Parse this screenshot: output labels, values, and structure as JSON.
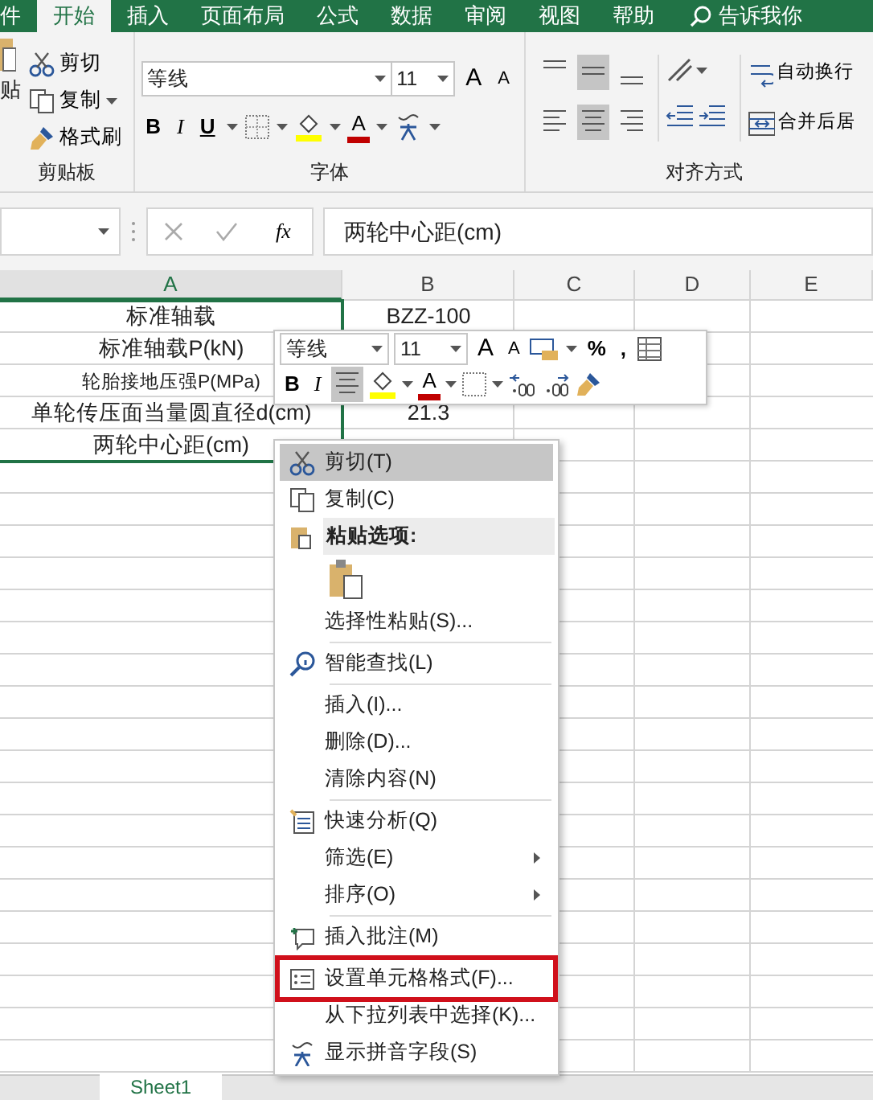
{
  "tabs": [
    {
      "label": "件",
      "selected": false
    },
    {
      "label": "开始",
      "selected": true
    },
    {
      "label": "插入",
      "selected": false
    },
    {
      "label": "页面布局",
      "selected": false
    },
    {
      "label": "公式",
      "selected": false
    },
    {
      "label": "数据",
      "selected": false
    },
    {
      "label": "审阅",
      "selected": false
    },
    {
      "label": "视图",
      "selected": false
    },
    {
      "label": "帮助",
      "selected": false
    }
  ],
  "search": {
    "label": "告诉我你"
  },
  "ribbon": {
    "clipboard": {
      "paste_label": "贴",
      "cut": "剪切",
      "copy": "复制",
      "format_painter": "格式刷",
      "label": "剪贴板"
    },
    "font": {
      "font": "等线",
      "size": "11",
      "grow": "A",
      "shrink": "A",
      "bold": "B",
      "italic": "I",
      "underline": "U",
      "font_color": "A",
      "label": "字体"
    },
    "alignment": {
      "align_buttons": [
        {
          "selected": false
        },
        {
          "selected": true
        },
        {
          "selected": false
        },
        {
          "selected": false
        },
        {
          "selected": true
        },
        {
          "selected": false
        }
      ],
      "wrap": "自动换行",
      "merge": "合并后居",
      "label": "对齐方式"
    }
  },
  "formula_bar": {
    "fx": "fx",
    "value": "两轮中心距(cm)"
  },
  "columns": [
    {
      "label": "A",
      "selected": true
    },
    {
      "label": "B",
      "selected": false
    },
    {
      "label": "C",
      "selected": false
    },
    {
      "label": "D",
      "selected": false
    },
    {
      "label": "E",
      "selected": false
    }
  ],
  "rows": [
    {
      "cells": [
        "标准轴载",
        "BZZ-100"
      ],
      "selected": true
    },
    {
      "cells": [
        "标准轴载P(kN)",
        ""
      ],
      "selected": true
    },
    {
      "cells": [
        "轮胎接地压强P(MPa)",
        ""
      ],
      "selected": true
    },
    {
      "cells": [
        "单轮传压面当量圆直径d(cm)",
        "21.3"
      ],
      "selected": true
    },
    {
      "cells": [
        "两轮中心距(cm)",
        ""
      ],
      "selected": true
    }
  ],
  "mini_toolbar": {
    "font": "等线",
    "size": "11",
    "grow": "A",
    "shrink": "A",
    "percent": "%",
    "comma": ",",
    "bold": "B",
    "italic": "I",
    "center_selected": true,
    "font_color": "A"
  },
  "context_menu": {
    "items": [
      {
        "kind": "item",
        "label": "剪切(T)",
        "highlighted": true,
        "submenu": false,
        "marked": false
      },
      {
        "kind": "item",
        "label": "复制(C)",
        "highlighted": false,
        "submenu": false,
        "marked": false
      },
      {
        "kind": "header",
        "label": "粘贴选项:"
      },
      {
        "kind": "paste"
      },
      {
        "kind": "item",
        "label": "选择性粘贴(S)...",
        "highlighted": false,
        "submenu": false,
        "marked": false
      },
      {
        "kind": "separator"
      },
      {
        "kind": "item",
        "label": "智能查找(L)",
        "highlighted": false,
        "submenu": false,
        "marked": false
      },
      {
        "kind": "separator"
      },
      {
        "kind": "item",
        "label": "插入(I)...",
        "highlighted": false,
        "submenu": false,
        "marked": false
      },
      {
        "kind": "item",
        "label": "删除(D)...",
        "highlighted": false,
        "submenu": false,
        "marked": false
      },
      {
        "kind": "item",
        "label": "清除内容(N)",
        "highlighted": false,
        "submenu": false,
        "marked": false
      },
      {
        "kind": "separator"
      },
      {
        "kind": "item",
        "label": "快速分析(Q)",
        "highlighted": false,
        "submenu": false,
        "marked": false
      },
      {
        "kind": "item",
        "label": "筛选(E)",
        "highlighted": false,
        "submenu": true,
        "marked": false
      },
      {
        "kind": "item",
        "label": "排序(O)",
        "highlighted": false,
        "submenu": true,
        "marked": false
      },
      {
        "kind": "separator"
      },
      {
        "kind": "item",
        "label": "插入批注(M)",
        "highlighted": false,
        "submenu": false,
        "marked": false
      },
      {
        "kind": "separator"
      },
      {
        "kind": "item",
        "label": "设置单元格格式(F)...",
        "highlighted": false,
        "submenu": false,
        "marked": true
      },
      {
        "kind": "item",
        "label": "从下拉列表中选择(K)...",
        "highlighted": false,
        "submenu": false,
        "marked": false
      },
      {
        "kind": "item",
        "label": "显示拼音字段(S)",
        "highlighted": false,
        "submenu": false,
        "marked": false
      }
    ]
  },
  "sheet_tabs": [
    {
      "label": "Sheet1",
      "selected": true
    }
  ]
}
